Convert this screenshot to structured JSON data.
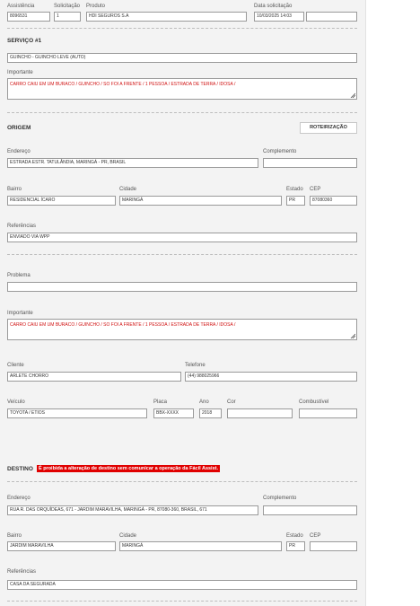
{
  "top": {
    "assistencia_label": "Assistência",
    "assistencia_value": "8096531",
    "solicitacao_label": "Solicitação",
    "solicitacao_value": "1",
    "produto_label": "Produto",
    "produto_value": "HDI SEGUROS S.A",
    "data_label": "Data solicitação",
    "data_value": "10/03/2025 14:03",
    "extra_value": ""
  },
  "servico": {
    "title": "SERVIÇO #1",
    "tipo_value": "GUINCHO - GUINCHO LEVE (AUTO)",
    "importante_label": "Importante",
    "importante_value": "CARRO CAIU EM UM BURACO / GUINCHO / SO FOI A FRENTE /  1 PESSOA / ESTRADA DE TERRA /  IDOSA /"
  },
  "origem": {
    "title": "ORIGEM",
    "roteirizacao_label": "ROTEIRIZAÇÃO",
    "endereco_label": "Endereço",
    "endereco_value": "ESTRADA ESTR. TATULÂNDIA, MARINGÁ - PR, BRASIL",
    "complemento_label": "Complemento",
    "complemento_value": "",
    "bairro_label": "Bairro",
    "bairro_value": "RESIDENCIAL ÍCARO",
    "cidade_label": "Cidade",
    "cidade_value": "MARINGÁ",
    "estado_label": "Estado",
    "estado_value": "PR",
    "cep_label": "CEP",
    "cep_value": "87080360",
    "referencias_label": "Referências",
    "referencias_value": "ENVIADO VIA WPP"
  },
  "detalhes": {
    "problema_label": "Problema",
    "problema_value": "",
    "importante_label": "Importante",
    "importante_value": "CARRO CAIU EM UM BURACO / GUINCHO / SO FOI A FRENTE /  1 PESSOA / ESTRADA DE TERRA /  IDOSA /",
    "cliente_label": "Cliente",
    "cliente_value": "ARLETE CHORRO",
    "telefone_label": "Telefone",
    "telefone_value": "(44) 988025966",
    "veiculo_label": "Veículo",
    "veiculo_value": "TOYOTA / ETIOS",
    "placa_label": "Placa",
    "placa_value": "BBX-XXXX",
    "ano_label": "Ano",
    "ano_value": "2018",
    "cor_label": "Cor",
    "cor_value": "",
    "combustivel_label": "Combustível",
    "combustivel_value": ""
  },
  "destino": {
    "title": "DESTINO",
    "warning": "É proibida a alteração de destino sem comunicar a operação da Fácil Assist.",
    "endereco_label": "Endereço",
    "endereco_value": "RUA R. DAS ORQUÍDEAS, 671 - JARDIM MARAVILHA, MARINGÁ - PR, 87080-360, BRASIL, 671",
    "complemento_label": "Complemento",
    "complemento_value": "",
    "bairro_label": "Bairro",
    "bairro_value": "JARDIM MARAVILHA",
    "cidade_label": "Cidade",
    "cidade_value": "MARINGÁ",
    "estado_label": "Estado",
    "estado_value": "PR",
    "cep_label": "CEP",
    "cep_value": "",
    "referencias_label": "Referências",
    "referencias_value": "CASA DA SEGURADA"
  },
  "colors": {
    "warning_bg": "#e00000",
    "important_text": "#d01010"
  }
}
